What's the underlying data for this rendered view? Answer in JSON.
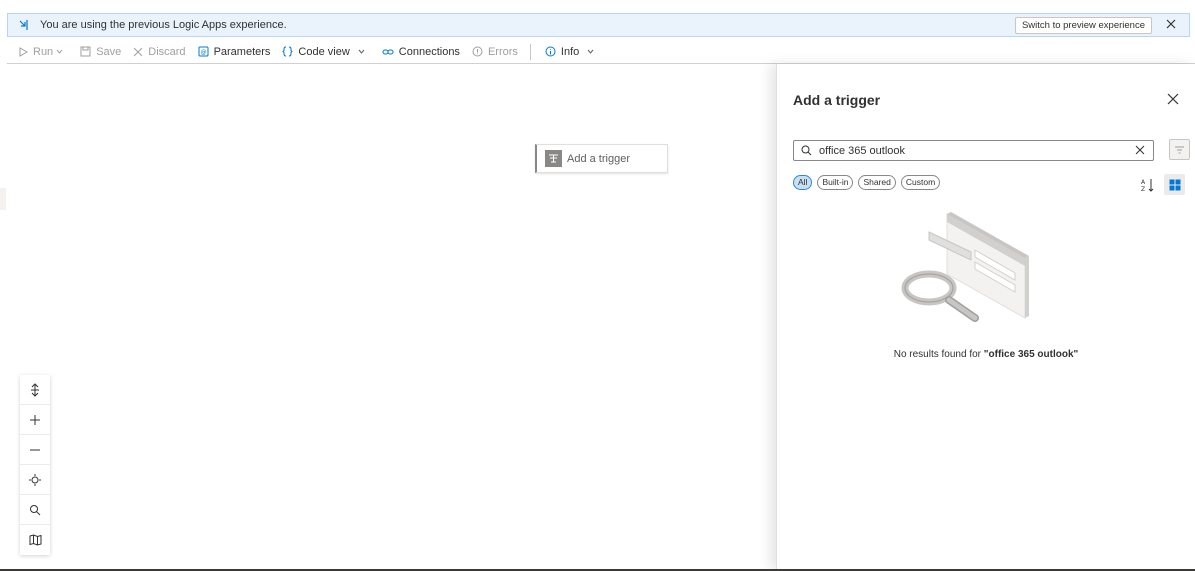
{
  "banner": {
    "text": "You are using the previous Logic Apps experience.",
    "switch_label": "Switch to preview experience"
  },
  "toolbar": {
    "run_label": "Run",
    "save_label": "Save",
    "discard_label": "Discard",
    "parameters_label": "Parameters",
    "code_view_label": "Code view",
    "connections_label": "Connections",
    "errors_label": "Errors",
    "info_label": "Info"
  },
  "canvas": {
    "trigger_card_label": "Add a trigger",
    "zoom_controls": [
      "fit-height-icon",
      "zoom-in-icon",
      "zoom-out-icon",
      "fit-view-icon",
      "search-icon",
      "minimap-icon"
    ]
  },
  "panel": {
    "title": "Add a trigger",
    "search": {
      "value": "office 365 outlook",
      "placeholder": "Search"
    },
    "filters": [
      "All",
      "Built-in",
      "Shared",
      "Custom"
    ],
    "active_filter": "All",
    "no_results_prefix": "No results found for ",
    "no_results_query": "\"office 365 outlook\""
  },
  "colors": {
    "accent": "#0078d4",
    "banner_bg": "#eaf3fc",
    "active_pill": "#c7e0f4"
  }
}
